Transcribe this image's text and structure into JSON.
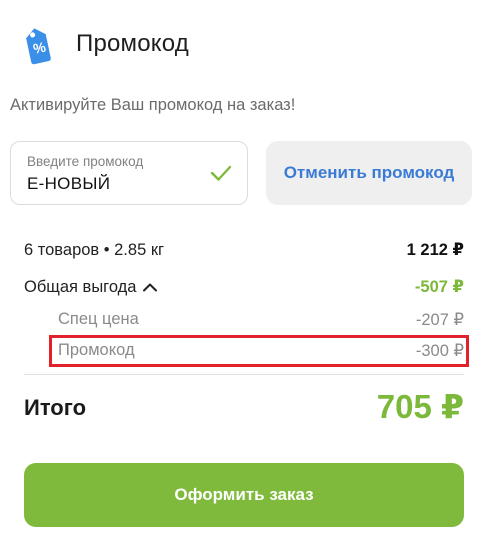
{
  "header": {
    "title": "Промокод",
    "icon": "discount-tag-icon"
  },
  "subtitle": "Активируйте Ваш промокод на заказ!",
  "promo": {
    "placeholder": "Введите промокод",
    "value": "Е-НОВЫЙ",
    "status_icon": "check-icon"
  },
  "cancel_button": {
    "label": "Отменить промокод"
  },
  "summary": {
    "items_label": "6 товаров • 2.85 кг",
    "items_amount": "1 212 ₽",
    "savings_label": "Общая выгода",
    "savings_amount": "-507 ₽",
    "special_price_label": "Спец цена",
    "special_price_amount": "-207 ₽",
    "promo_label": "Промокод",
    "promo_amount": "-300 ₽"
  },
  "total": {
    "label": "Итого",
    "amount": "705 ₽"
  },
  "order_button": {
    "label": "Оформить заказ"
  },
  "colors": {
    "accent_green": "#7fba3c",
    "link_blue": "#3a7bd5",
    "highlight_red": "#e3212b"
  }
}
